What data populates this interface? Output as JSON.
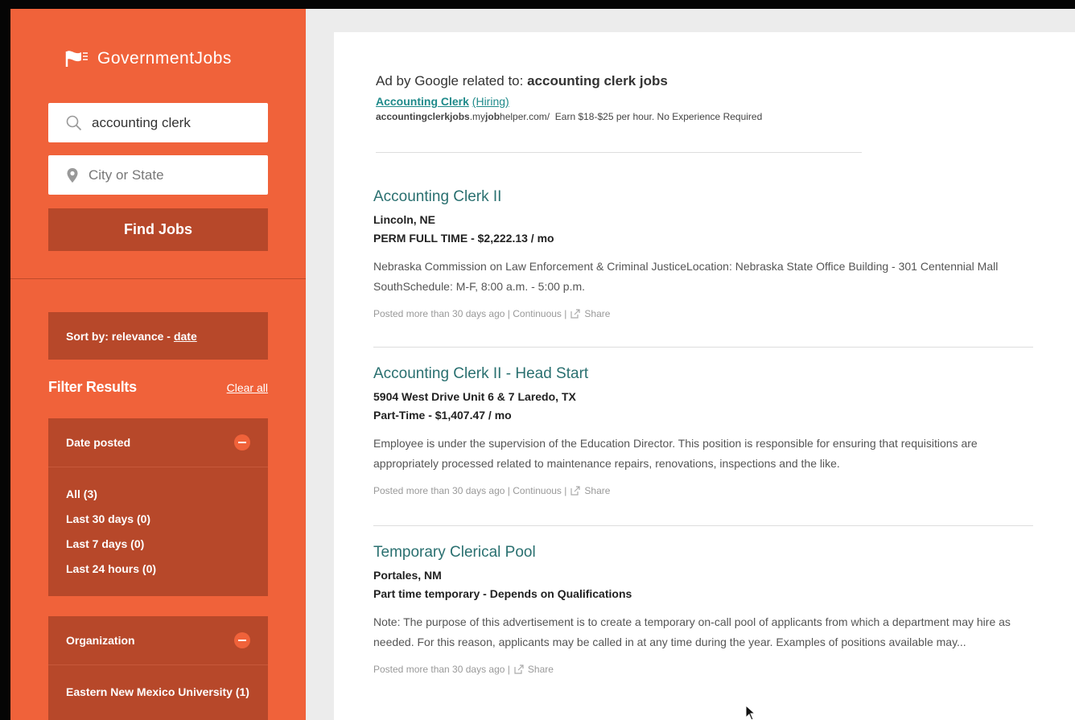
{
  "brand": {
    "name": "GovernmentJobs"
  },
  "search": {
    "keyword_value": "accounting clerk",
    "location_placeholder": "City or State",
    "find_label": "Find Jobs"
  },
  "sort": {
    "prefix": "Sort by: relevance -",
    "date_link": "date"
  },
  "filters": {
    "title": "Filter Results",
    "clear_label": "Clear all",
    "date_posted": {
      "title": "Date posted",
      "options": [
        "All (3)",
        "Last 30 days (0)",
        "Last 7 days (0)",
        "Last 24 hours (0)"
      ]
    },
    "organization": {
      "title": "Organization",
      "options": [
        "Eastern New Mexico University (1)"
      ]
    }
  },
  "ad": {
    "prefix": "Ad by Google related to:",
    "query": "accounting clerk jobs",
    "title": "Accounting Clerk",
    "hiring": "(Hiring)",
    "url_a": "accountingclerkjobs",
    "url_b": ".my",
    "url_c": "job",
    "url_d": "helper.com/",
    "description": "Earn $18-$25 per hour. No Experience Required"
  },
  "jobs": [
    {
      "title": "Accounting Clerk II",
      "location": "Lincoln, NE",
      "type_pay": "PERM FULL TIME - $2,222.13 / mo",
      "description": "Nebraska Commission on Law Enforcement & Criminal JusticeLocation: Nebraska State Office Building - 301 Centennial Mall SouthSchedule: M-F, 8:00 a.m. - 5:00 p.m.",
      "meta": "Posted more than 30 days ago | Continuous |",
      "share": "Share"
    },
    {
      "title": "Accounting Clerk II - Head Start",
      "location": "5904 West Drive Unit 6 & 7 Laredo, TX",
      "type_pay": "Part-Time - $1,407.47 / mo",
      "description": "Employee is under the supervision of the Education Director.  This position is responsible for ensuring that requisitions are appropriately processed related to maintenance repairs, renovations, inspections and the like.",
      "meta": "Posted more than 30 days ago | Continuous |",
      "share": "Share"
    },
    {
      "title": "Temporary Clerical Pool",
      "location": "Portales, NM",
      "type_pay": "Part time temporary - Depends on Qualifications",
      "description": "Note: The purpose of this advertisement is to create a temporary on-call pool of applicants from which a department may hire as needed. For this reason, applicants may be called in at any time during the year. Examples of positions available may...",
      "meta": "Posted more than 30 days ago |",
      "share": "Share"
    }
  ],
  "colors": {
    "sidebar": "#f0623a",
    "panel": "#b7482a",
    "job_title": "#2a7070",
    "ad_link": "#1f8a8a"
  }
}
